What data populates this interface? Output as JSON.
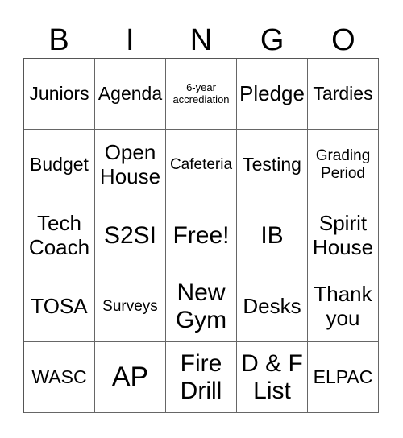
{
  "header": {
    "letters": [
      "B",
      "I",
      "N",
      "G",
      "O"
    ]
  },
  "cells": [
    {
      "text": "Juniors",
      "size": "s-md"
    },
    {
      "text": "Agenda",
      "size": "s-md"
    },
    {
      "text": "6-year accrediation",
      "size": "s-xs"
    },
    {
      "text": "Pledge",
      "size": "s-lg"
    },
    {
      "text": "Tardies",
      "size": "s-md"
    },
    {
      "text": "Budget",
      "size": "s-md"
    },
    {
      "text": "Open House",
      "size": "s-lg"
    },
    {
      "text": "Cafeteria",
      "size": "s-sm"
    },
    {
      "text": "Testing",
      "size": "s-md"
    },
    {
      "text": "Grading Period",
      "size": "s-sm"
    },
    {
      "text": "Tech Coach",
      "size": "s-lg"
    },
    {
      "text": "S2SI",
      "size": "s-xl"
    },
    {
      "text": "Free!",
      "size": "s-xl"
    },
    {
      "text": "IB",
      "size": "s-xl"
    },
    {
      "text": "Spirit House",
      "size": "s-lg"
    },
    {
      "text": "TOSA",
      "size": "s-lg"
    },
    {
      "text": "Surveys",
      "size": "s-sm"
    },
    {
      "text": "New Gym",
      "size": "s-xl"
    },
    {
      "text": "Desks",
      "size": "s-lg"
    },
    {
      "text": "Thank you",
      "size": "s-lg"
    },
    {
      "text": "WASC",
      "size": "s-md"
    },
    {
      "text": "AP",
      "size": "s-xxl"
    },
    {
      "text": "Fire Drill",
      "size": "s-xl"
    },
    {
      "text": "D & F List",
      "size": "s-xl"
    },
    {
      "text": "ELPAC",
      "size": "s-md"
    }
  ]
}
